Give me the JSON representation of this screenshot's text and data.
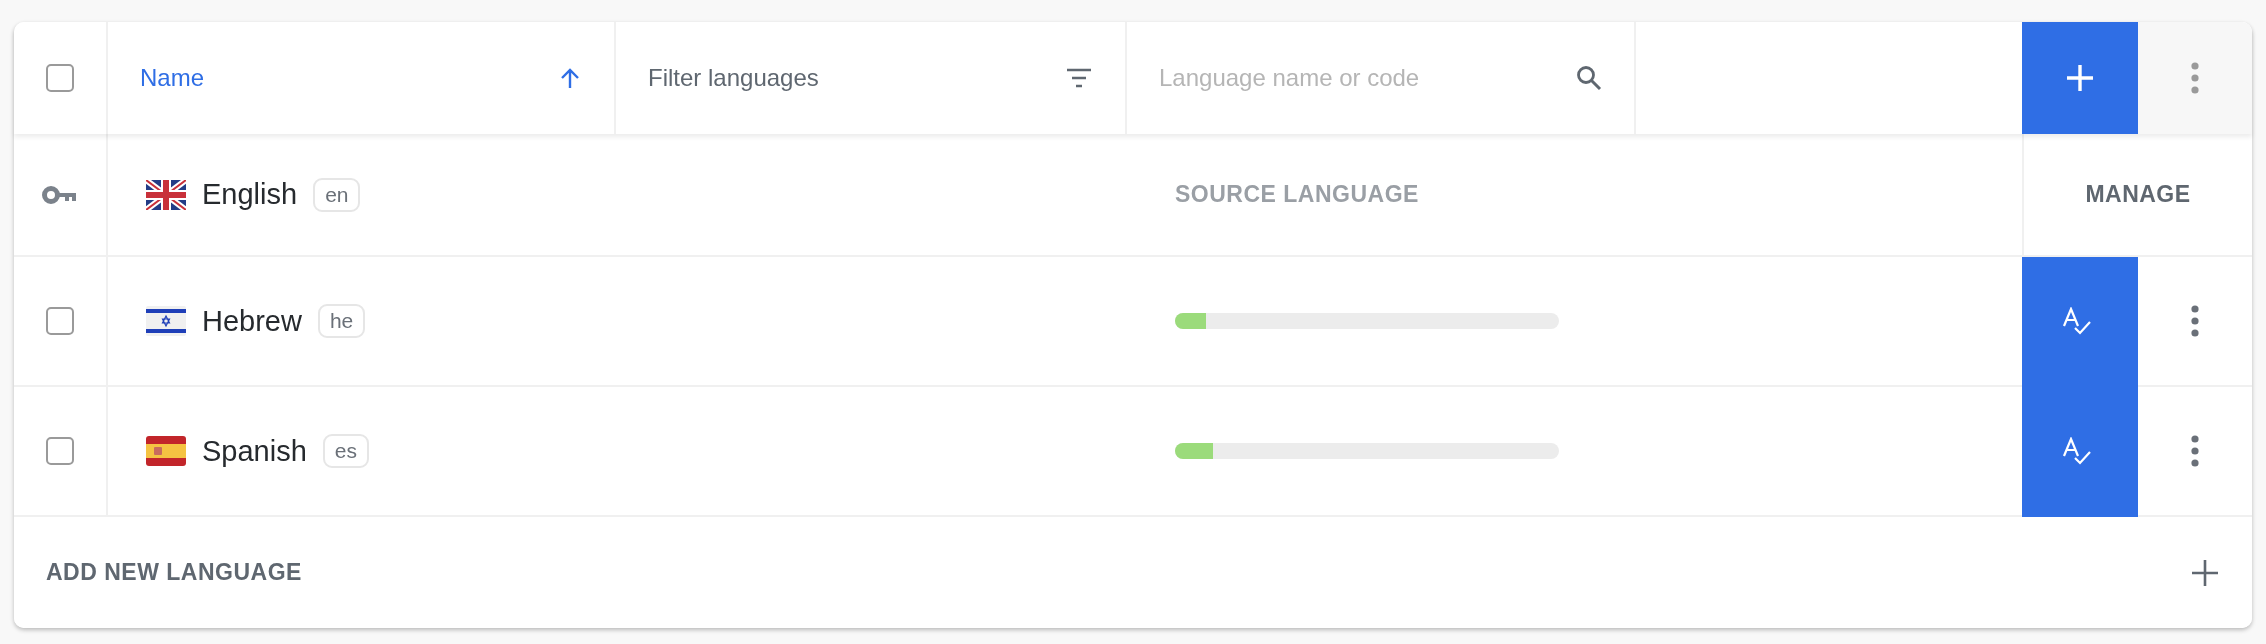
{
  "header": {
    "select_all": {
      "checked": false
    },
    "sort": {
      "label": "Name",
      "ascending": true
    },
    "filter": {
      "label": "Filter languages"
    },
    "search": {
      "placeholder": "Language name or code"
    }
  },
  "languages": [
    {
      "kind": "base",
      "name": "English",
      "code": "en",
      "status": "SOURCE LANGUAGE",
      "action": "MANAGE"
    },
    {
      "kind": "translation",
      "name": "Hebrew",
      "code": "he",
      "checked": false,
      "level": 0.08
    },
    {
      "kind": "translation",
      "name": "Spanish",
      "code": "es",
      "checked": false,
      "level": 0.1
    }
  ],
  "footer": {
    "label": "ADD NEW LANGUAGE"
  }
}
